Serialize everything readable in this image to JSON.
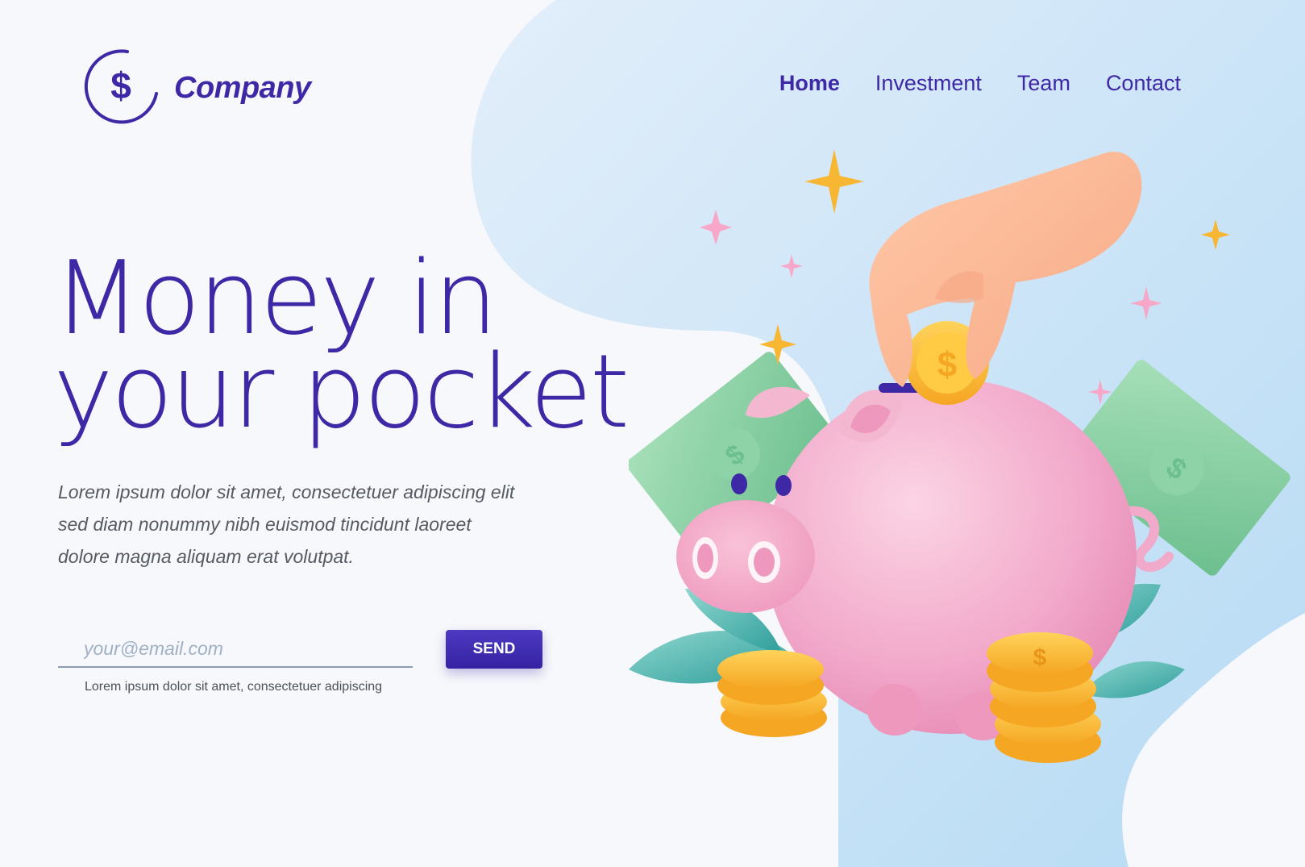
{
  "brand": {
    "name": "Company",
    "logo_icon": "dollar-circle-icon"
  },
  "nav": {
    "items": [
      {
        "label": "Home",
        "active": true
      },
      {
        "label": "Investment",
        "active": false
      },
      {
        "label": "Team",
        "active": false
      },
      {
        "label": "Contact",
        "active": false
      }
    ]
  },
  "hero": {
    "title_line1": "Money in",
    "title_line2": "your pocket",
    "description": "Lorem ipsum dolor sit amet, consectetuer adipiscing elit sed diam nonummy nibh euismod tincidunt laoreet dolore magna aliquam erat volutpat."
  },
  "signup": {
    "email_placeholder": "your@email.com",
    "send_label": "SEND",
    "note": "Lorem ipsum dolor sit amet, consectetuer adipiscing"
  },
  "colors": {
    "primary": "#3e28a6",
    "background": "#f7f8fb",
    "blob": "#cfe6f8"
  }
}
